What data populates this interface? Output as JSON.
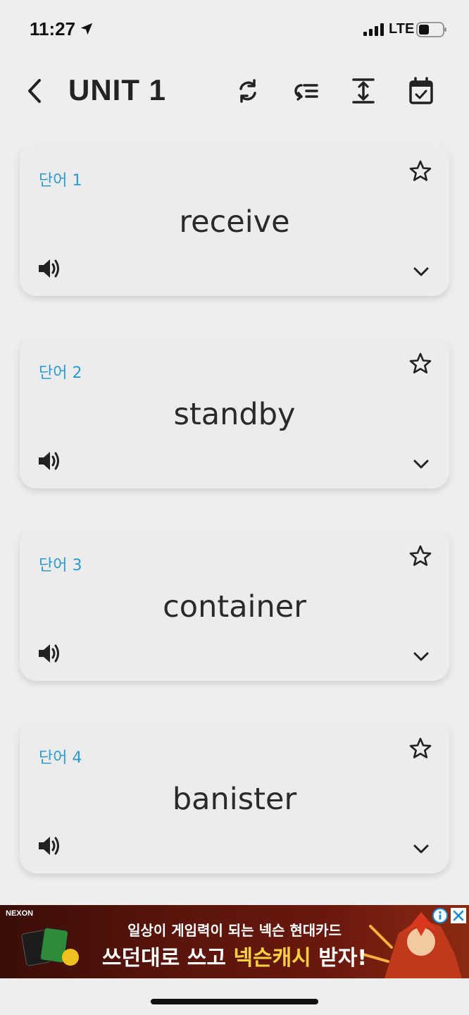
{
  "status_bar": {
    "time": "11:27",
    "network": "LTE",
    "icons": [
      "location-arrow-icon",
      "cellular-signal-icon",
      "battery-icon"
    ]
  },
  "header": {
    "title": "UNIT 1",
    "icons": [
      "back-chevron-icon",
      "refresh-icon",
      "list-loop-icon",
      "expand-vertical-icon",
      "calendar-check-icon"
    ]
  },
  "cards": [
    {
      "label": "단어 1",
      "word": "receive"
    },
    {
      "label": "단어 2",
      "word": "standby"
    },
    {
      "label": "단어 3",
      "word": "container"
    },
    {
      "label": "단어 4",
      "word": "banister"
    }
  ],
  "ad": {
    "brand": "NEXON",
    "line1_a": "일상이 ",
    "line1_b": "게임력",
    "line1_c": "이 되는 넥슨 현대카드",
    "line2_a": "쓰던대로 쓰고 ",
    "line2_b": "넥슨캐시",
    "line2_c": " 받자!",
    "icons": [
      "info-icon",
      "close-icon"
    ]
  },
  "colors": {
    "background": "#eeeeee",
    "card": "#ececec",
    "accent": "#2a9ad6",
    "text": "#222222",
    "ad_bg": "#5c150c",
    "ad_highlight": "#ffd23f"
  }
}
